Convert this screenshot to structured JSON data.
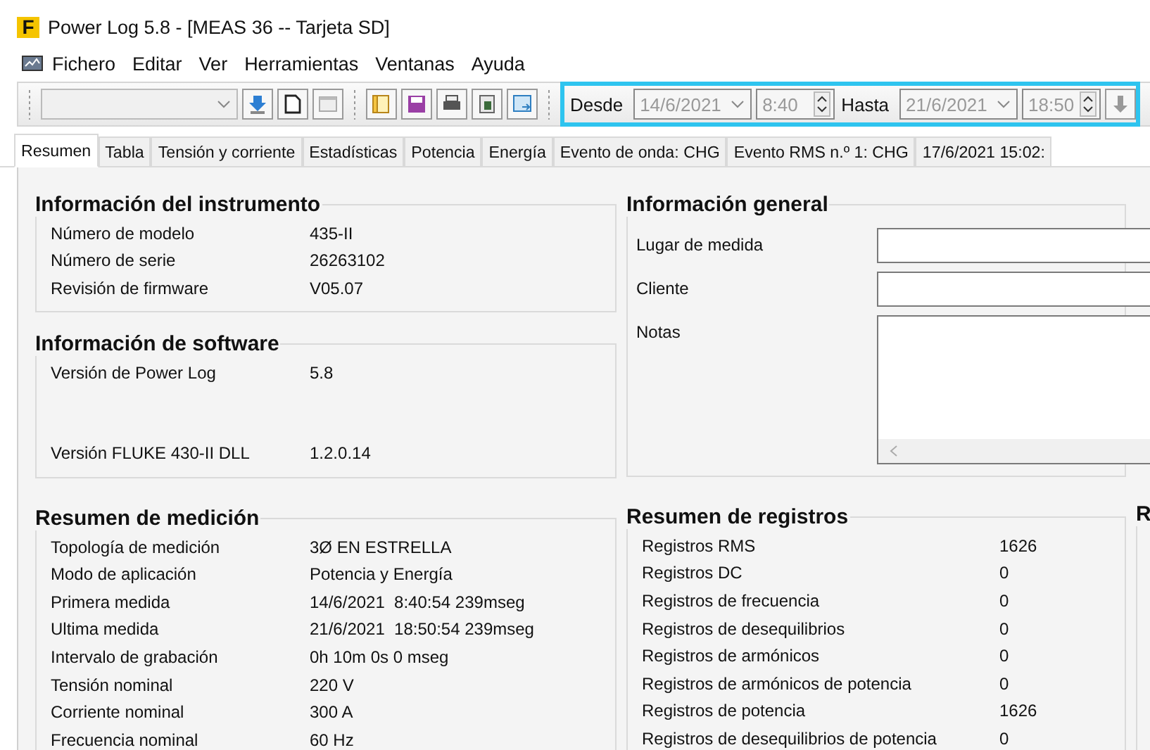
{
  "window": {
    "logo": "F",
    "title": "Power Log 5.8 - [MEAS 36 -- Tarjeta SD]"
  },
  "menu": [
    "Fichero",
    "Editar",
    "Ver",
    "Herramientas",
    "Ventanas",
    "Ayuda"
  ],
  "date_range": {
    "from_label": "Desde",
    "from_date": "14/6/2021",
    "from_time": "8:40",
    "to_label": "Hasta",
    "to_date": "21/6/2021",
    "to_time": "18:50"
  },
  "tabs": [
    {
      "label": "Resumen",
      "selected": true
    },
    {
      "label": "Tabla",
      "selected": false
    },
    {
      "label": "Tensión y corriente",
      "selected": false
    },
    {
      "label": "Estadísticas",
      "selected": false
    },
    {
      "label": "Potencia",
      "selected": false
    },
    {
      "label": "Energía",
      "selected": false
    },
    {
      "label": "Evento de onda: CHG",
      "selected": false
    },
    {
      "label": "Evento RMS n.º 1: CHG",
      "selected": false
    },
    {
      "label": "17/6/2021 15:02:",
      "selected": false
    }
  ],
  "instrument_info": {
    "title": "Información del instrumento",
    "rows": [
      {
        "label": "Número de modelo",
        "value": "435-II"
      },
      {
        "label": "Número de serie",
        "value": "26263102"
      },
      {
        "label": "Revisión de firmware",
        "value": "V05.07"
      }
    ]
  },
  "software_info": {
    "title": "Información de software",
    "rows": [
      {
        "label": "Versión de Power Log",
        "value": "5.8"
      },
      {
        "label": "Versión FLUKE 430-II DLL",
        "value": "1.2.0.14"
      }
    ]
  },
  "general_info": {
    "title": "Información general",
    "fields": [
      {
        "label": "Lugar de medida",
        "kind": "line"
      },
      {
        "label": "Cliente",
        "kind": "line"
      },
      {
        "label": "Notas",
        "kind": "multiline"
      }
    ]
  },
  "measurement_summary": {
    "title": "Resumen de medición",
    "rows": [
      {
        "label": "Topología de medición",
        "value": "3Ø EN ESTRELLA"
      },
      {
        "label": "Modo de aplicación",
        "value": "Potencia y Energía"
      },
      {
        "label": "Primera medida",
        "value": "14/6/2021  8:40:54 239mseg"
      },
      {
        "label": "Ultima medida",
        "value": "21/6/2021  18:50:54 239mseg"
      },
      {
        "label": "Intervalo de grabación",
        "value": "0h 10m 0s 0 mseg"
      },
      {
        "label": "Tensión nominal",
        "value": "220 V"
      },
      {
        "label": "Corriente nominal",
        "value": "300 A"
      },
      {
        "label": "Frecuencia nominal",
        "value": "60 Hz"
      }
    ]
  },
  "records_summary": {
    "title": "Resumen de registros",
    "rows": [
      {
        "label": "Registros RMS",
        "value": "1626"
      },
      {
        "label": "Registros DC",
        "value": "0"
      },
      {
        "label": "Registros de frecuencia",
        "value": "0"
      },
      {
        "label": "Registros de desequilibrios",
        "value": "0"
      },
      {
        "label": "Registros de armónicos",
        "value": "0"
      },
      {
        "label": "Registros de armónicos de potencia",
        "value": "0"
      },
      {
        "label": "Registros de potencia",
        "value": "1626"
      },
      {
        "label": "Registros de desequilibrios de potencia",
        "value": "0"
      }
    ]
  },
  "third_panel": {
    "title": "R"
  }
}
